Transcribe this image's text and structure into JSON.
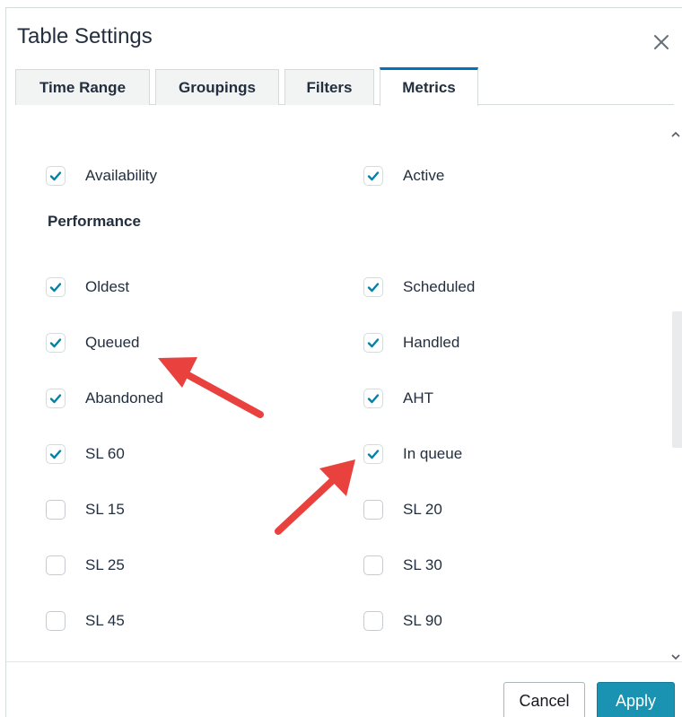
{
  "dialog": {
    "title": "Table Settings",
    "close_icon": "close-icon"
  },
  "tabs": [
    {
      "label": "Time Range",
      "active": false
    },
    {
      "label": "Groupings",
      "active": false
    },
    {
      "label": "Filters",
      "active": false
    },
    {
      "label": "Metrics",
      "active": true
    }
  ],
  "metrics": {
    "availability": {
      "label": "Availability",
      "checked": true
    },
    "active": {
      "label": "Active",
      "checked": true
    },
    "performance_heading": "Performance",
    "oldest": {
      "label": "Oldest",
      "checked": true
    },
    "scheduled": {
      "label": "Scheduled",
      "checked": true
    },
    "queued": {
      "label": "Queued",
      "checked": true
    },
    "handled": {
      "label": "Handled",
      "checked": true
    },
    "abandoned": {
      "label": "Abandoned",
      "checked": true
    },
    "aht": {
      "label": "AHT",
      "checked": true
    },
    "sl60": {
      "label": "SL 60",
      "checked": true
    },
    "in_queue": {
      "label": "In queue",
      "checked": true
    },
    "sl15": {
      "label": "SL 15",
      "checked": false
    },
    "sl20": {
      "label": "SL 20",
      "checked": false
    },
    "sl25": {
      "label": "SL 25",
      "checked": false
    },
    "sl30": {
      "label": "SL 30",
      "checked": false
    },
    "sl45": {
      "label": "SL 45",
      "checked": false
    },
    "sl90": {
      "label": "SL 90",
      "checked": false
    }
  },
  "footer": {
    "cancel_label": "Cancel",
    "apply_label": "Apply"
  },
  "colors": {
    "accent": "#0073bb",
    "check": "#0a7fa3",
    "apply_bg": "#1a93b2",
    "annotation_arrow": "#e8413e"
  },
  "annotations": {
    "arrow_icon": "annotation-arrow"
  }
}
